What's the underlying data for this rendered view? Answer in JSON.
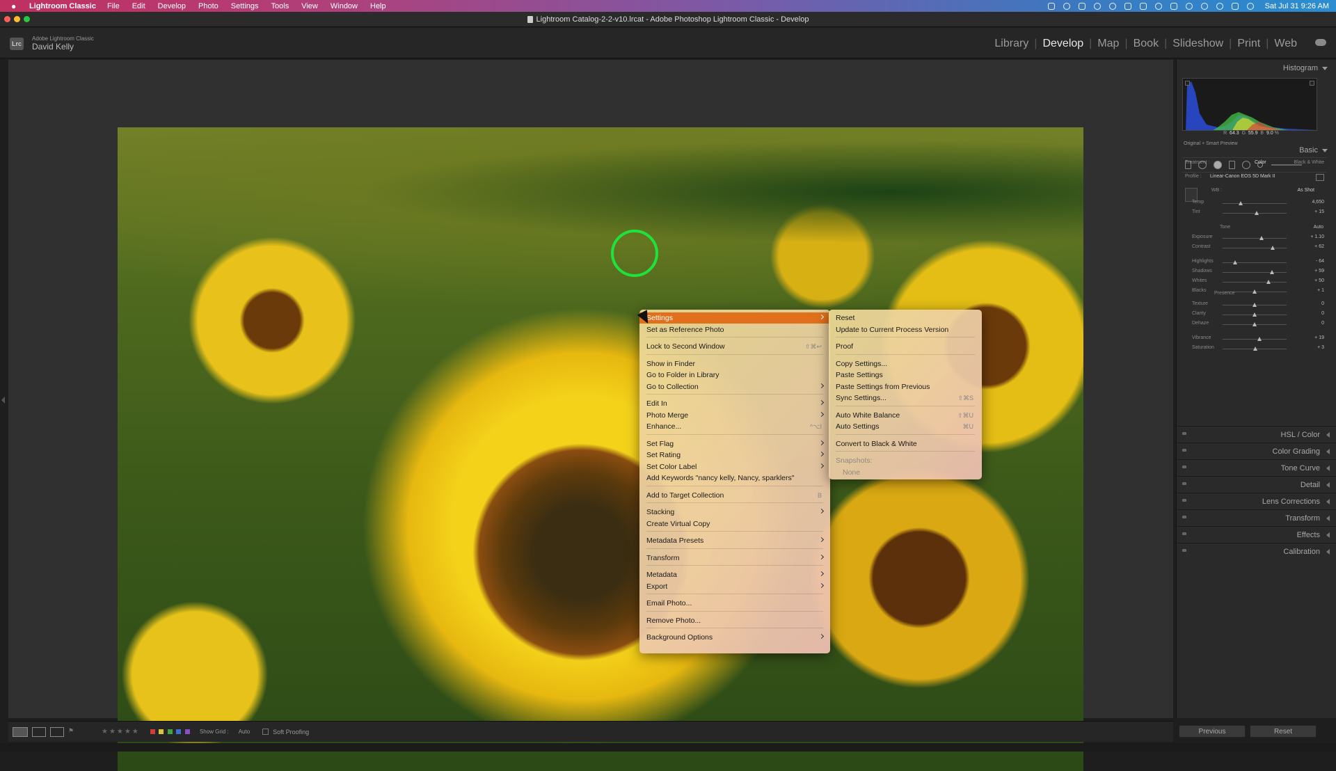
{
  "menubar": {
    "app_name": "Lightroom Classic",
    "items": [
      "File",
      "Edit",
      "Develop",
      "Photo",
      "Settings",
      "Tools",
      "View",
      "Window",
      "Help"
    ],
    "clock": "Sat Jul 31  9:26 AM"
  },
  "window": {
    "title": "Lightroom Catalog-2-2-v10.lrcat - Adobe Photoshop Lightroom Classic - Develop"
  },
  "identity": {
    "badge": "Lrc",
    "product": "Adobe Lightroom Classic",
    "user": "David Kelly"
  },
  "modules": [
    "Library",
    "Develop",
    "Map",
    "Book",
    "Slideshow",
    "Print",
    "Web"
  ],
  "active_module": "Develop",
  "right_panel": {
    "histogram_title": "Histogram",
    "readout": {
      "r_label": "R",
      "r": "64.3",
      "g_label": "G",
      "g": "55.9",
      "b_label": "B",
      "b": "9.0",
      "unit": "%"
    },
    "preview_label": "Original + Smart Preview",
    "basic_title": "Basic",
    "treatment_label": "Treatment :",
    "treatment_color": "Color",
    "treatment_bw": "Black & White",
    "profile_label": "Profile :",
    "profile_value": "Linear-Canon EOS 5D Mark II",
    "wb_label": "WB :",
    "wb_value": "As Shot",
    "temp": {
      "label": "Temp",
      "value": "4,650",
      "pos": 0.28
    },
    "tint": {
      "label": "Tint",
      "value": "+ 15",
      "pos": 0.53
    },
    "tone_label": "Tone",
    "auto_label": "Auto",
    "tone_sliders": [
      {
        "label": "Exposure",
        "value": "+ 1.10",
        "pos": 0.61
      },
      {
        "label": "Contrast",
        "value": "+ 62",
        "pos": 0.78
      },
      {
        "label": "Highlights",
        "value": "- 64",
        "pos": 0.2
      },
      {
        "label": "Shadows",
        "value": "+ 59",
        "pos": 0.77
      },
      {
        "label": "Whites",
        "value": "+ 50",
        "pos": 0.72
      },
      {
        "label": "Blacks",
        "value": "+ 1",
        "pos": 0.5
      }
    ],
    "presence_label": "Presence",
    "presence_sliders": [
      {
        "label": "Texture",
        "value": "0",
        "pos": 0.5
      },
      {
        "label": "Clarity",
        "value": "0",
        "pos": 0.5
      },
      {
        "label": "Dehaze",
        "value": "0",
        "pos": 0.5
      },
      {
        "label": "Vibrance",
        "value": "+ 19",
        "pos": 0.58
      },
      {
        "label": "Saturation",
        "value": "+ 3",
        "pos": 0.51
      }
    ],
    "collapsed_panels": [
      "HSL / Color",
      "Color Grading",
      "Tone Curve",
      "Detail",
      "Lens Corrections",
      "Transform",
      "Effects",
      "Calibration"
    ]
  },
  "bottom_bar": {
    "show_grid": "Show Grid :",
    "auto": "Auto",
    "soft_proofing": "Soft Proofing",
    "stars": "★★★★★",
    "color_labels": [
      "#d13b3b",
      "#d8c53a",
      "#3fa63f",
      "#3b6fd1",
      "#8a4fc7"
    ],
    "previous": "Previous",
    "reset": "Reset"
  },
  "context_menu": {
    "items": [
      {
        "label": "Settings",
        "sub": true,
        "hl": true
      },
      {
        "label": "Set as Reference Photo"
      },
      {
        "label": "Lock to Second Window",
        "sc": "⇧⌘↩"
      },
      {
        "label": "Show in Finder"
      },
      {
        "label": "Go to Folder in Library"
      },
      {
        "label": "Go to Collection",
        "sub": true
      },
      {
        "label": "Edit In",
        "sub": true
      },
      {
        "label": "Photo Merge",
        "sub": true
      },
      {
        "label": "Enhance...",
        "sc": "^⌥I"
      },
      {
        "label": "Set Flag",
        "sub": true
      },
      {
        "label": "Set Rating",
        "sub": true
      },
      {
        "label": "Set Color Label",
        "sub": true
      },
      {
        "label": "Add Keywords \"nancy kelly, Nancy, sparklers\""
      },
      {
        "label": "Add to Target Collection",
        "sc": "B"
      },
      {
        "label": "Stacking",
        "sub": true
      },
      {
        "label": "Create Virtual Copy"
      },
      {
        "label": "Metadata Presets",
        "sub": true
      },
      {
        "label": "Transform",
        "sub": true
      },
      {
        "label": "Metadata",
        "sub": true
      },
      {
        "label": "Export",
        "sub": true
      },
      {
        "label": "Email Photo..."
      },
      {
        "label": "Remove Photo..."
      },
      {
        "label": "Background Options",
        "sub": true
      }
    ]
  },
  "settings_submenu": {
    "items": [
      {
        "label": "Reset"
      },
      {
        "label": "Update to Current Process Version"
      },
      {
        "label": "Proof"
      },
      {
        "label": "Copy Settings..."
      },
      {
        "label": "Paste Settings"
      },
      {
        "label": "Paste Settings from Previous"
      },
      {
        "label": "Sync Settings...",
        "sc": "⇧⌘S"
      },
      {
        "label": "Auto White Balance",
        "sc": "⇧⌘U"
      },
      {
        "label": "Auto Settings",
        "sc": "⌘U"
      },
      {
        "label": "Convert to Black & White"
      },
      {
        "label": "Snapshots:",
        "dis": true
      },
      {
        "label": "None",
        "dis": true,
        "indent": true
      }
    ]
  }
}
